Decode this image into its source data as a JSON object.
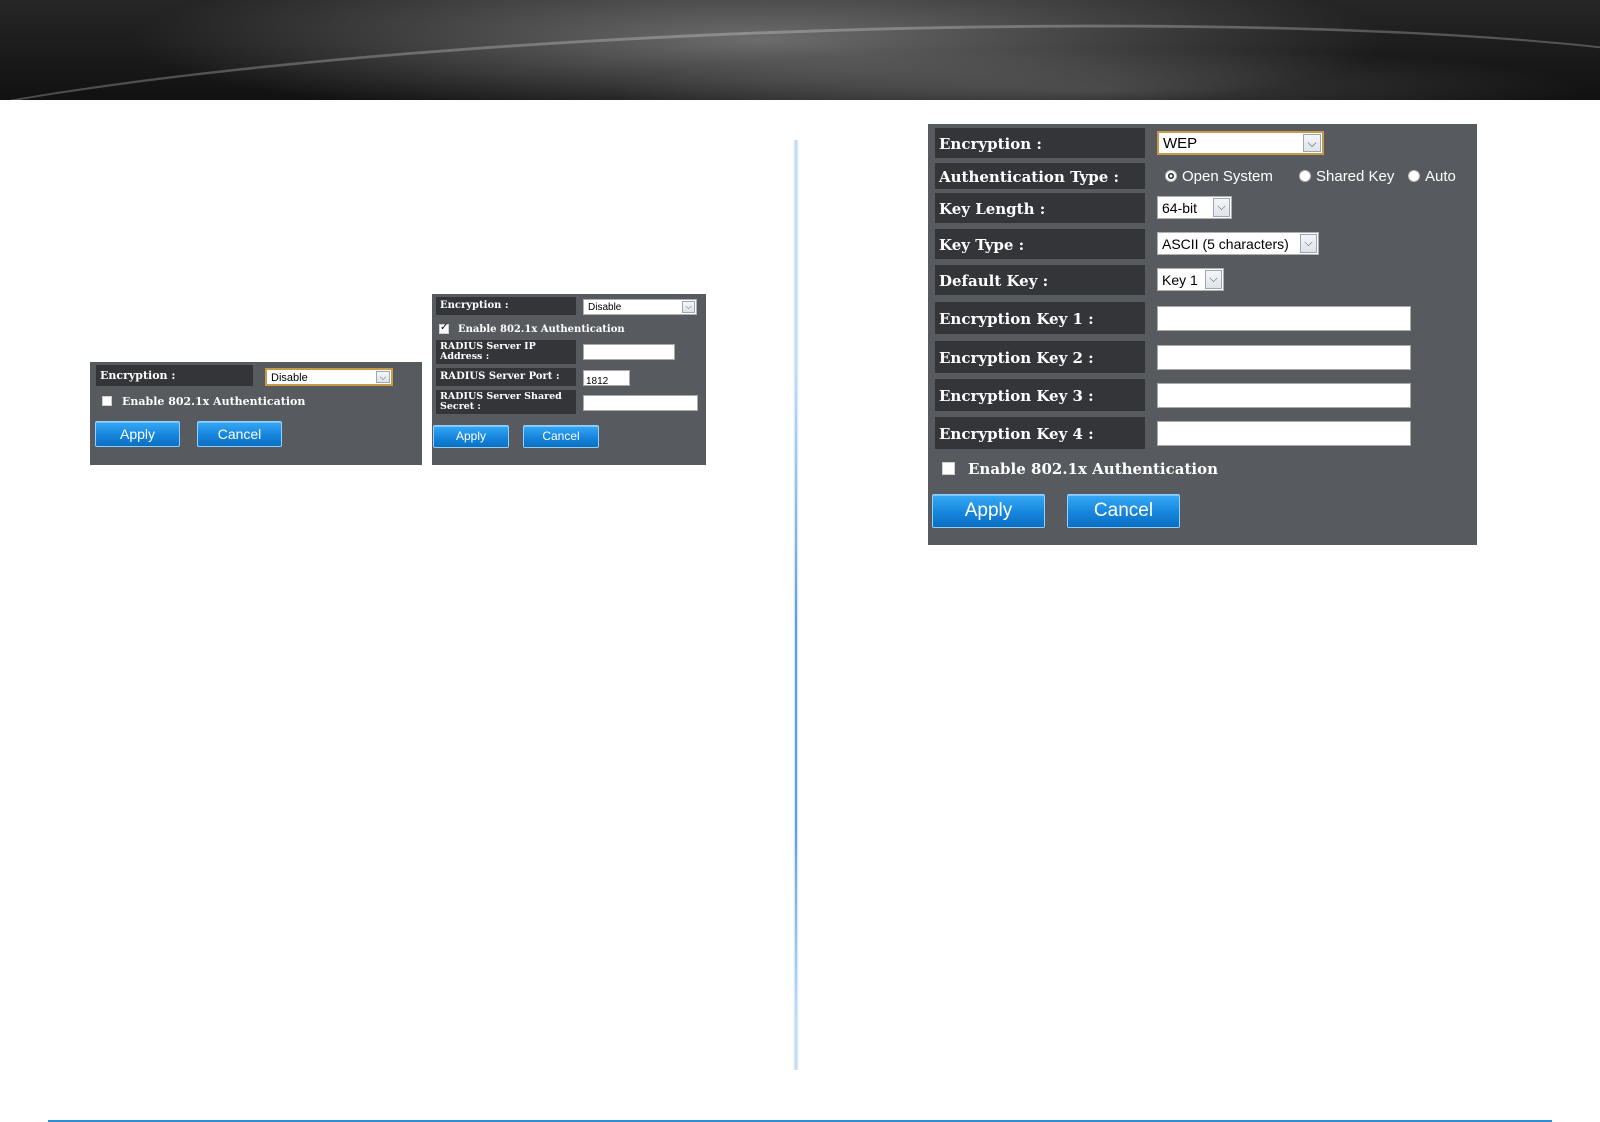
{
  "panel_small": {
    "encryption_label": "Encryption :",
    "encryption_value": "Disable",
    "enable_8021x_label": "Enable 802.1x Authentication",
    "enable_8021x_checked": false,
    "apply_label": "Apply",
    "cancel_label": "Cancel"
  },
  "panel_radius": {
    "encryption_label": "Encryption :",
    "encryption_value": "Disable",
    "enable_8021x_label": "Enable 802.1x Authentication",
    "enable_8021x_checked": true,
    "radius_ip_label": "RADIUS Server IP Address :",
    "radius_ip_value": "",
    "radius_port_label": "RADIUS Server Port :",
    "radius_port_value": "1812",
    "radius_secret_label": "RADIUS Server Shared Secret :",
    "radius_secret_value": "",
    "apply_label": "Apply",
    "cancel_label": "Cancel"
  },
  "panel_wep": {
    "encryption_label": "Encryption :",
    "encryption_value": "WEP",
    "auth_type_label": "Authentication Type :",
    "auth_options": [
      "Open System",
      "Shared Key",
      "Auto"
    ],
    "auth_selected": "Open System",
    "key_length_label": "Key Length :",
    "key_length_value": "64-bit",
    "key_type_label": "Key Type :",
    "key_type_value": "ASCII (5 characters)",
    "default_key_label": "Default Key :",
    "default_key_value": "Key 1",
    "key1_label": "Encryption Key 1 :",
    "key2_label": "Encryption Key 2 :",
    "key3_label": "Encryption Key 3 :",
    "key4_label": "Encryption Key 4 :",
    "enable_8021x_label": "Enable 802.1x Authentication",
    "enable_8021x_checked": false,
    "apply_label": "Apply",
    "cancel_label": "Cancel"
  },
  "icons": {
    "dropdown": "chevron-down-icon",
    "checkbox_checked": "check-icon"
  }
}
